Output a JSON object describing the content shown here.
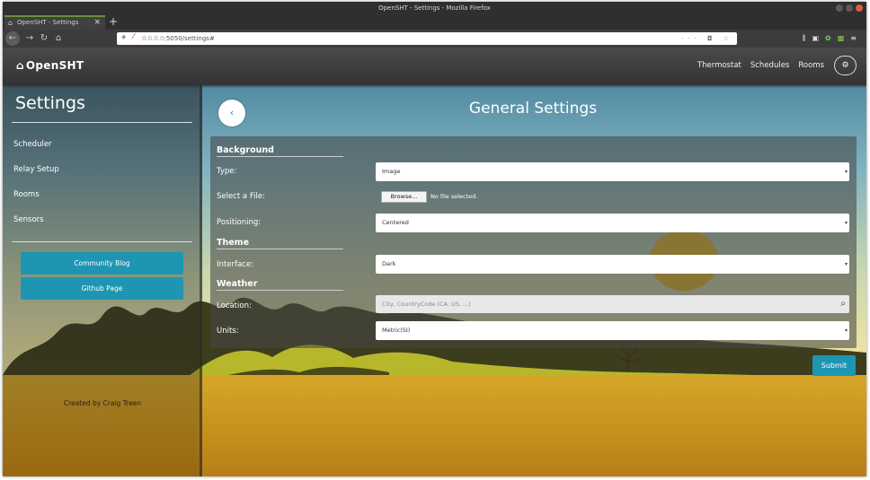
{
  "browser": {
    "window_title": "OpenSHT - Settings - Mozilla Firefox",
    "tab_label": "OpenSHT - Settings",
    "url_host": "0.0.0.0",
    "url_rest": ":5050/settings#"
  },
  "header": {
    "brand": "OpenSHT",
    "nav": [
      "Thermostat",
      "Schedules",
      "Rooms"
    ]
  },
  "sidebar": {
    "title": "Settings",
    "items": [
      "Scheduler",
      "Relay Setup",
      "Rooms",
      "Sensors"
    ],
    "buttons": [
      "Community Blog",
      "Github Page"
    ],
    "credit": "Created by Craig Treen"
  },
  "main": {
    "title": "General Settings",
    "sections": {
      "background": "Background",
      "theme": "Theme",
      "weather": "Weather"
    },
    "fields": {
      "type_label": "Type:",
      "type_value": "Image",
      "file_label": "Select a File:",
      "browse_label": "Browse...",
      "file_status": "No file selected.",
      "positioning_label": "Positioning:",
      "positioning_value": "Centered",
      "interface_label": "Interface:",
      "interface_value": "Dark",
      "location_label": "Location:",
      "location_placeholder": "City, CountryCode (CA, US, ...)",
      "units_label": "Units:",
      "units_value": "Metric(SI)"
    },
    "submit_label": "Submit"
  },
  "colors": {
    "accent": "#1e95b3",
    "header": "#3a3a3a",
    "sun": "#e2b21a",
    "ground": "#d6a629"
  }
}
